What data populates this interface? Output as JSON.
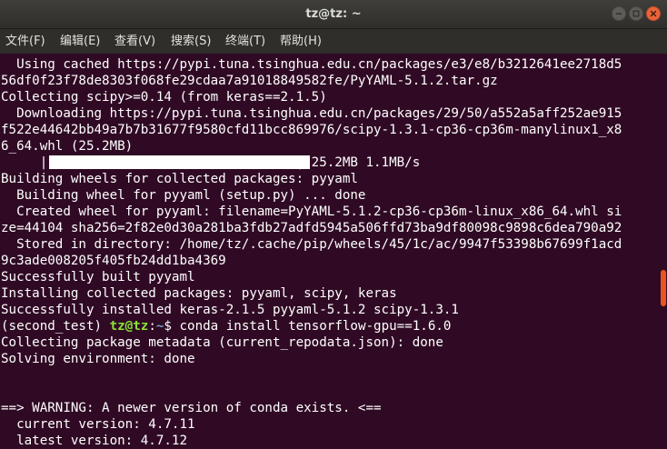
{
  "window": {
    "title": "tz@tz: ~"
  },
  "menu": {
    "file": "文件(F)",
    "edit": "编辑(E)",
    "view": "查看(V)",
    "search": "搜索(S)",
    "terminal": "终端(T)",
    "help": "帮助(H)"
  },
  "terminal": {
    "lines": [
      "  Using cached https://pypi.tuna.tsinghua.edu.cn/packages/e3/e8/b3212641ee2718d5",
      "56df0f23f78de8303f068fe29cdaa7a91018849582fe/PyYAML-5.1.2.tar.gz",
      "Collecting scipy>=0.14 (from keras==2.1.5)",
      "  Downloading https://pypi.tuna.tsinghua.edu.cn/packages/29/50/a552a5aff252ae915",
      "f522e44642bb49a7b7b31677f9580cfd11bcc869976/scipy-1.3.1-cp36-cp36m-manylinux1_x8",
      "6_64.whl (25.2MB)",
      "     |                                | 25.2MB 1.1MB/s",
      "Building wheels for collected packages: pyyaml",
      "  Building wheel for pyyaml (setup.py) ... done",
      "  Created wheel for pyyaml: filename=PyYAML-5.1.2-cp36-cp36m-linux_x86_64.whl si",
      "ze=44104 sha256=2f82e0d30a281ba3fdb27adfd5945a506ffd73ba9df80098c9898c6dea790a92",
      "  Stored in directory: /home/tz/.cache/pip/wheels/45/1c/ac/9947f53398b67699f1acd",
      "9c3ade008205f405fb24dd1ba4369",
      "Successfully built pyyaml",
      "Installing collected packages: pyyaml, scipy, keras",
      "Successfully installed keras-2.1.5 pyyaml-5.1.2 scipy-1.3.1",
      "",
      "Collecting package metadata (current_repodata.json): done",
      "Solving environment: done",
      "",
      "",
      "==> WARNING: A newer version of conda exists. <==",
      "  current version: 4.7.11",
      "  latest version: 4.7.12"
    ],
    "prompt": {
      "env": "(second_test) ",
      "user_host": "tz@tz",
      "sep": ":",
      "dir": "~",
      "symbol": "$ ",
      "command": "conda install tensorflow-gpu==1.6.0"
    },
    "download_progress": 1.0
  },
  "colors": {
    "background": "#300a24",
    "text": "#ffffff",
    "prompt_user": "#8ae234",
    "prompt_dir": "#729fcf",
    "scroll_thumb": "#e95420",
    "close_button": "#e8633b"
  },
  "icons": [
    "minimize-icon",
    "maximize-icon",
    "close-icon"
  ]
}
